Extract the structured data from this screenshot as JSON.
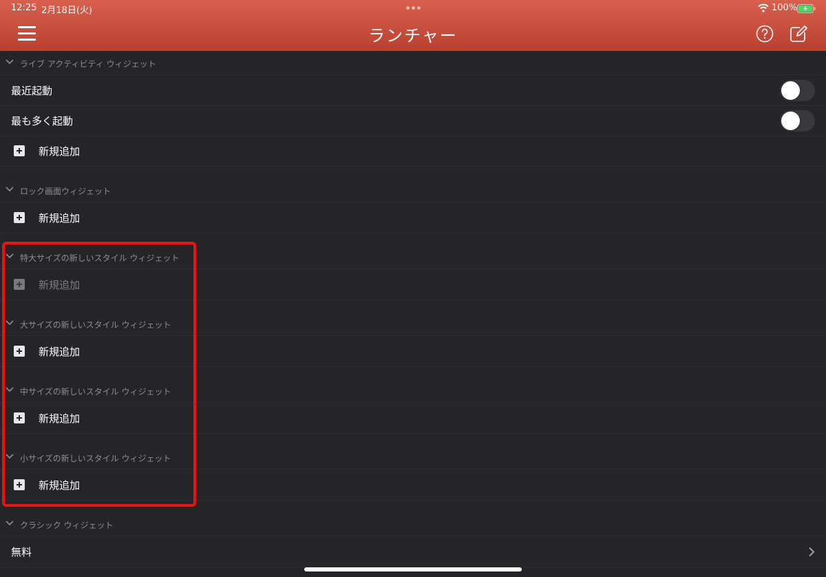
{
  "status_bar": {
    "time": "12:25",
    "date": "2月18日(火)",
    "battery": "100%"
  },
  "header": {
    "title": "ランチャー",
    "icons": [
      "menu-icon",
      "help-icon",
      "edit-icon"
    ],
    "accent_color": "#c94c3b"
  },
  "sections": {
    "live_activity": {
      "title": "ライブ アクティビティ ウィジェット",
      "items": [
        {
          "label": "最近起動",
          "toggle_on": false
        },
        {
          "label": "最も多く起動",
          "toggle_on": false
        }
      ],
      "add_label": "新規追加"
    },
    "lock_screen": {
      "title": "ロック画面ウィジェット",
      "add_label": "新規追加"
    },
    "extra_large": {
      "title": "特大サイズの新しいスタイル ウィジェット",
      "add_label": "新規追加",
      "add_disabled": true
    },
    "large": {
      "title": "大サイズの新しいスタイル ウィジェット",
      "add_label": "新規追加"
    },
    "medium": {
      "title": "中サイズの新しいスタイル ウィジェット",
      "add_label": "新規追加"
    },
    "small": {
      "title": "小サイズの新しいスタイル ウィジェット",
      "add_label": "新規追加"
    },
    "classic": {
      "title": "クラシック ウィジェット",
      "items": [
        {
          "label": "無料"
        }
      ]
    }
  },
  "colors": {
    "background": "#252528",
    "highlight": "#ef1111",
    "section_text": "#8e8e93"
  }
}
